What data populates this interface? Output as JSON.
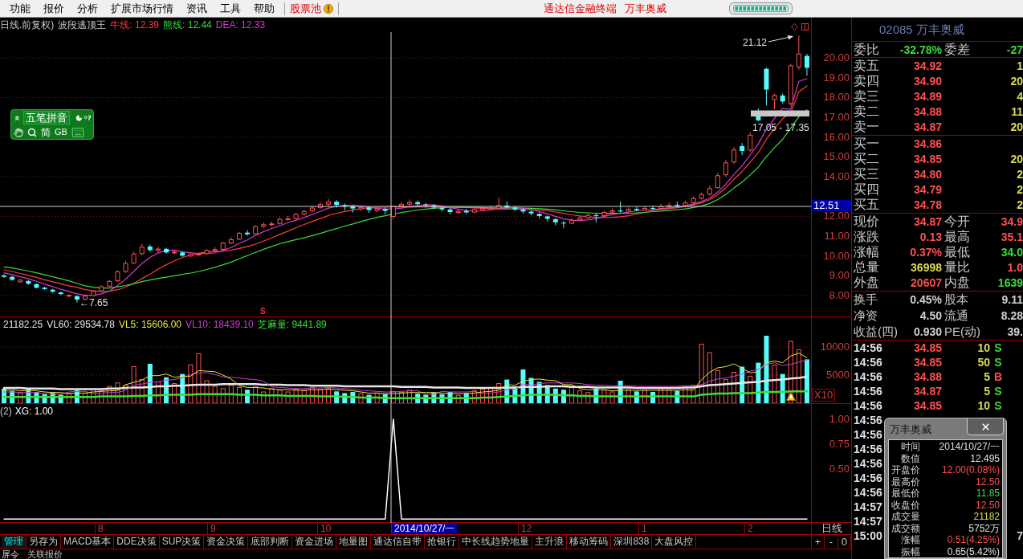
{
  "menu_bar": {
    "items": [
      "功能",
      "报价",
      "分析",
      "扩展市场行情",
      "资讯",
      "工具",
      "帮助"
    ],
    "stock_pool": "股票池",
    "app_title": "通达信金融终端",
    "stock_name": "万丰奥威"
  },
  "main_chart": {
    "title": "日线.前复权)",
    "indicator_name": "波段逃顶王",
    "crosshair_price": "12.51",
    "range_label": "17.05 - 17.35",
    "high_label": "21.12",
    "low_label": "←7.65",
    "signal_mark": "S",
    "chart_data": {
      "type": "candlestick",
      "grid": true,
      "ylim": [
        6.95,
        22.03
      ],
      "yticks": [
        {
          "value": 20,
          "label": "20.00"
        },
        {
          "value": 19,
          "label": "19.00"
        },
        {
          "value": 18,
          "label": "18.00"
        },
        {
          "value": 17,
          "label": "17.00"
        },
        {
          "value": 16,
          "label": "16.00"
        },
        {
          "value": 15,
          "label": "15.00"
        },
        {
          "value": 14,
          "label": "14.00"
        },
        {
          "value": 12,
          "label": "12.00"
        },
        {
          "value": 11,
          "label": "11.00"
        },
        {
          "value": 10,
          "label": "10.00"
        },
        {
          "value": 9,
          "label": "9.00"
        },
        {
          "value": 8,
          "label": "8.00"
        }
      ],
      "ohlc": [
        [
          9.02,
          9.08,
          8.9,
          8.95
        ],
        [
          8.95,
          8.99,
          8.76,
          8.8
        ],
        [
          8.7,
          8.84,
          8.66,
          8.78
        ],
        [
          8.74,
          8.78,
          8.55,
          8.6
        ],
        [
          8.58,
          8.62,
          8.36,
          8.4
        ],
        [
          8.4,
          8.45,
          8.28,
          8.33
        ],
        [
          8.3,
          8.34,
          8.14,
          8.2
        ],
        [
          8.16,
          8.2,
          8.02,
          8.08
        ],
        [
          7.98,
          8.06,
          7.92,
          8.02
        ],
        [
          7.98,
          8.0,
          7.65,
          7.8
        ],
        [
          7.82,
          8.02,
          7.78,
          7.98
        ],
        [
          8.0,
          8.28,
          7.96,
          8.22
        ],
        [
          8.24,
          8.52,
          8.2,
          8.45
        ],
        [
          8.48,
          8.8,
          8.44,
          8.72
        ],
        [
          8.75,
          9.28,
          8.7,
          9.2
        ],
        [
          9.22,
          9.75,
          9.15,
          9.62
        ],
        [
          9.65,
          10.22,
          9.6,
          10.1
        ],
        [
          10.12,
          10.62,
          10.05,
          10.45
        ],
        [
          10.48,
          10.58,
          10.22,
          10.3
        ],
        [
          10.3,
          10.45,
          10.2,
          10.35
        ],
        [
          10.36,
          10.42,
          10.12,
          10.18
        ],
        [
          10.16,
          10.28,
          10.08,
          10.2
        ],
        [
          10.18,
          10.24,
          9.96,
          10.02
        ],
        [
          10.0,
          10.15,
          9.95,
          10.08
        ],
        [
          10.08,
          10.18,
          10.02,
          10.1
        ],
        [
          10.12,
          10.35,
          10.06,
          10.28
        ],
        [
          10.3,
          10.45,
          10.22,
          10.32
        ],
        [
          10.34,
          10.72,
          10.3,
          10.65
        ],
        [
          10.66,
          10.95,
          10.6,
          10.82
        ],
        [
          10.85,
          11.22,
          10.8,
          11.15
        ],
        [
          11.18,
          11.3,
          11.02,
          11.1
        ],
        [
          11.12,
          11.55,
          11.08,
          11.48
        ],
        [
          11.5,
          11.7,
          11.42,
          11.58
        ],
        [
          11.6,
          11.75,
          11.5,
          11.62
        ],
        [
          11.64,
          11.95,
          11.58,
          11.85
        ],
        [
          11.86,
          12.02,
          11.78,
          11.88
        ],
        [
          11.9,
          12.18,
          11.85,
          12.1
        ],
        [
          12.12,
          12.35,
          12.05,
          12.25
        ],
        [
          12.28,
          12.55,
          12.2,
          12.42
        ],
        [
          12.45,
          12.72,
          12.38,
          12.6
        ],
        [
          12.62,
          12.88,
          12.5,
          12.72
        ],
        [
          12.74,
          12.82,
          12.45,
          12.58
        ],
        [
          12.56,
          12.65,
          12.3,
          12.5
        ],
        [
          12.5,
          12.58,
          12.2,
          12.4
        ],
        [
          12.38,
          12.55,
          12.28,
          12.45
        ],
        [
          12.45,
          12.52,
          12.18,
          12.32
        ],
        [
          12.3,
          12.48,
          12.22,
          12.38
        ],
        [
          12.38,
          12.45,
          12.1,
          12.28
        ],
        [
          12.0,
          12.5,
          11.85,
          12.5
        ],
        [
          12.52,
          12.72,
          12.45,
          12.6
        ],
        [
          12.62,
          12.85,
          12.55,
          12.7
        ],
        [
          12.72,
          12.8,
          12.52,
          12.62
        ],
        [
          12.6,
          12.68,
          12.45,
          12.55
        ],
        [
          12.55,
          12.62,
          12.38,
          12.45
        ],
        [
          12.42,
          12.5,
          12.25,
          12.35
        ],
        [
          12.35,
          12.42,
          12.1,
          12.22
        ],
        [
          12.2,
          12.35,
          12.12,
          12.26
        ],
        [
          12.28,
          12.38,
          12.12,
          12.2
        ],
        [
          12.22,
          12.42,
          12.18,
          12.34
        ],
        [
          12.34,
          12.48,
          12.28,
          12.4
        ],
        [
          12.4,
          12.55,
          12.32,
          12.44
        ],
        [
          12.42,
          12.95,
          12.38,
          12.55
        ],
        [
          12.55,
          12.75,
          12.4,
          12.45
        ],
        [
          12.45,
          12.52,
          12.25,
          12.35
        ],
        [
          12.35,
          12.42,
          12.15,
          12.25
        ],
        [
          12.24,
          12.3,
          12.05,
          12.15
        ],
        [
          12.12,
          12.2,
          11.92,
          12.02
        ],
        [
          12.0,
          12.05,
          11.75,
          11.88
        ],
        [
          11.86,
          11.92,
          11.55,
          11.7
        ],
        [
          11.68,
          11.78,
          11.4,
          11.66
        ],
        [
          11.66,
          11.9,
          11.6,
          11.8
        ],
        [
          11.82,
          12.02,
          11.75,
          11.92
        ],
        [
          11.94,
          12.15,
          11.88,
          12.05
        ],
        [
          12.06,
          12.18,
          11.7,
          12.02
        ],
        [
          12.04,
          12.3,
          11.98,
          12.2
        ],
        [
          12.22,
          12.4,
          12.15,
          12.28
        ],
        [
          12.3,
          12.75,
          12.18,
          12.25
        ],
        [
          12.26,
          12.45,
          12.2,
          12.36
        ],
        [
          12.38,
          12.48,
          12.25,
          12.32
        ],
        [
          12.32,
          12.52,
          12.28,
          12.4
        ],
        [
          12.42,
          12.55,
          12.3,
          12.38
        ],
        [
          12.4,
          12.62,
          12.35,
          12.5
        ],
        [
          12.5,
          12.7,
          12.42,
          12.55
        ],
        [
          12.58,
          12.75,
          12.45,
          12.52
        ],
        [
          12.55,
          12.8,
          12.5,
          12.68
        ],
        [
          12.7,
          13.0,
          12.62,
          12.9
        ],
        [
          12.92,
          13.2,
          12.85,
          13.1
        ],
        [
          13.12,
          13.55,
          13.05,
          13.4
        ],
        [
          13.45,
          14.2,
          13.4,
          14.05
        ],
        [
          14.1,
          14.85,
          14.0,
          14.7
        ],
        [
          14.75,
          15.5,
          14.65,
          15.35
        ],
        [
          15.55,
          15.7,
          15.1,
          15.3
        ],
        [
          15.35,
          16.25,
          15.25,
          16.1
        ],
        [
          17.3,
          17.45,
          16.8,
          16.85
        ],
        [
          19.45,
          19.5,
          17.6,
          18.4
        ],
        [
          17.9,
          18.2,
          17.4,
          18.1
        ],
        [
          18.1,
          18.2,
          17.7,
          17.8
        ],
        [
          17.7,
          19.7,
          17.6,
          19.6
        ],
        [
          19.55,
          21.12,
          19.4,
          20.2
        ],
        [
          20.1,
          20.2,
          19.1,
          19.5
        ]
      ],
      "series": [
        {
          "type": "line",
          "name": "牛线: 12.39",
          "color": "#ff3c3c",
          "values": [
            9.3,
            9.22,
            9.12,
            9.02,
            8.92,
            8.8,
            8.7,
            8.6,
            8.5,
            8.42,
            8.3,
            8.24,
            8.21,
            8.22,
            8.3,
            8.43,
            8.62,
            8.86,
            9.08,
            9.34,
            9.56,
            9.76,
            9.92,
            10.05,
            10.14,
            10.21,
            10.23,
            10.25,
            10.3,
            10.38,
            10.48,
            10.6,
            10.76,
            10.91,
            11.09,
            11.25,
            11.43,
            11.59,
            11.75,
            11.89,
            12.05,
            12.16,
            12.25,
            12.33,
            12.39,
            12.44,
            12.46,
            12.47,
            12.48,
            12.48,
            12.47,
            12.48,
            12.48,
            12.49,
            12.48,
            12.47,
            12.46,
            12.45,
            12.43,
            12.41,
            12.39,
            12.38,
            12.37,
            12.36,
            12.35,
            12.34,
            12.32,
            12.29,
            12.22,
            12.15,
            12.08,
            12.02,
            11.98,
            11.95,
            11.94,
            11.95,
            11.98,
            12.03,
            12.12,
            12.2,
            12.3,
            12.35,
            12.4,
            12.44,
            12.5,
            12.58,
            12.69,
            12.84,
            13.1,
            13.45,
            13.87,
            14.26,
            14.74,
            15.21,
            15.9,
            16.44,
            16.93,
            17.2,
            18.29,
            18.59
          ]
        },
        {
          "type": "line",
          "name": "熊线: 12.44",
          "color": "#3cdc3c",
          "values": [
            9.45,
            9.4,
            9.32,
            9.24,
            9.15,
            9.05,
            8.95,
            8.85,
            8.75,
            8.62,
            8.5,
            8.42,
            8.38,
            8.38,
            8.44,
            8.51,
            8.6,
            8.71,
            8.79,
            8.87,
            8.93,
            9.0,
            9.07,
            9.14,
            9.22,
            9.32,
            9.43,
            9.56,
            9.69,
            9.86,
            10.02,
            10.18,
            10.34,
            10.48,
            10.62,
            10.73,
            10.83,
            10.92,
            11.03,
            11.14,
            11.27,
            11.38,
            11.51,
            11.62,
            11.74,
            11.85,
            11.95,
            12.03,
            12.12,
            12.19,
            12.26,
            12.32,
            12.37,
            12.41,
            12.44,
            12.46,
            12.46,
            12.46,
            12.46,
            12.45,
            12.43,
            12.43,
            12.43,
            12.43,
            12.42,
            12.41,
            12.39,
            12.37,
            12.33,
            12.28,
            12.24,
            12.2,
            12.18,
            12.16,
            12.15,
            12.15,
            12.15,
            12.16,
            12.17,
            12.2,
            12.24,
            12.27,
            12.31,
            12.34,
            12.38,
            12.45,
            12.53,
            12.65,
            12.85,
            13.11,
            13.43,
            13.73,
            14.09,
            14.48,
            15.02,
            15.47,
            15.89,
            16.45,
            17.03,
            17.38
          ]
        },
        {
          "type": "line",
          "name": "DEA: 12.33",
          "color": "#d23cd2",
          "values": [
            9.15,
            9.05,
            8.95,
            8.85,
            8.72,
            8.58,
            8.46,
            8.32,
            8.21,
            8.09,
            8.02,
            8.02,
            8.09,
            8.23,
            8.51,
            8.84,
            9.22,
            9.62,
            9.93,
            10.16,
            10.28,
            10.3,
            10.21,
            10.17,
            10.12,
            10.14,
            10.16,
            10.29,
            10.43,
            10.64,
            10.81,
            11.04,
            11.23,
            11.39,
            11.53,
            11.68,
            11.81,
            11.94,
            12.1,
            12.25,
            12.42,
            12.51,
            12.56,
            12.56,
            12.53,
            12.45,
            12.41,
            12.37,
            12.39,
            12.42,
            12.49,
            12.54,
            12.59,
            12.58,
            12.53,
            12.44,
            12.37,
            12.3,
            12.27,
            12.28,
            12.33,
            12.39,
            12.44,
            12.44,
            12.41,
            12.35,
            12.24,
            12.13,
            12.0,
            11.88,
            11.81,
            11.79,
            11.83,
            11.89,
            12.0,
            12.09,
            12.16,
            12.22,
            12.28,
            12.32,
            12.34,
            12.39,
            12.43,
            12.47,
            12.53,
            12.63,
            12.75,
            12.92,
            13.23,
            13.63,
            14.12,
            14.56,
            15.1,
            15.66,
            16.4,
            16.95,
            17.45,
            17.4,
            18.82,
            18.95
          ]
        }
      ]
    }
  },
  "input_method": {
    "mode": "五笔拼音",
    "script": "简",
    "charset": "GB"
  },
  "volume_chart": {
    "reading": "21182.25",
    "scale": "X10",
    "chart_data": {
      "type": "bar",
      "stacked": true,
      "grid": true,
      "ylim": [
        0,
        15285
      ],
      "yticks": [
        {
          "value": 10000,
          "label": "10000"
        },
        {
          "value": 5000,
          "label": "5000"
        }
      ],
      "series": [
        {
          "type": "bar",
          "color": "#ff5050",
          "values": [
            null,
            null,
            1800,
            null,
            null,
            null,
            null,
            null,
            1700,
            null,
            1800,
            2500,
            2200,
            3000,
            3600,
            3200,
            6500,
            4200,
            null,
            3800,
            null,
            3500,
            null,
            6800,
            8800,
            4000,
            3000,
            2600,
            3200,
            2800,
            null,
            2900,
            2000,
            2600,
            2300,
            2000,
            2500,
            2200,
            2800,
            2400,
            2600,
            null,
            null,
            null,
            1700,
            null,
            1800,
            null,
            2100,
            1900,
            2300,
            null,
            null,
            null,
            null,
            null,
            1400,
            null,
            2200,
            2500,
            2800,
            3500,
            null,
            null,
            null,
            null,
            null,
            null,
            null,
            null,
            2800,
            2200,
            1900,
            null,
            2300,
            2000,
            null,
            2400,
            null,
            2300,
            null,
            2600,
            2400,
            null,
            2800,
            3200,
            10500,
            9000,
            5800,
            4200,
            5500,
            null,
            4800,
            null,
            null,
            6800,
            null,
            11000,
            9500,
            null
          ]
        },
        {
          "type": "bar",
          "color": "#54fcfc",
          "values": [
            2600,
            2200,
            null,
            2400,
            2000,
            1600,
            1900,
            1500,
            null,
            2300,
            null,
            null,
            null,
            null,
            null,
            null,
            null,
            null,
            7000,
            null,
            4600,
            null,
            5200,
            null,
            null,
            null,
            null,
            null,
            null,
            null,
            2400,
            null,
            null,
            null,
            null,
            null,
            null,
            null,
            null,
            null,
            null,
            2100,
            1800,
            2000,
            null,
            1500,
            null,
            1600,
            null,
            null,
            null,
            1700,
            1500,
            1900,
            1600,
            2000,
            null,
            1800,
            null,
            null,
            null,
            null,
            4200,
            3000,
            6000,
            4500,
            3800,
            3200,
            2600,
            2400,
            null,
            null,
            null,
            2600,
            null,
            null,
            4000,
            null,
            2100,
            null,
            2000,
            null,
            null,
            2200,
            null,
            null,
            null,
            null,
            null,
            null,
            null,
            6500,
            null,
            7200,
            12000,
            null,
            5200,
            null,
            null,
            7800
          ]
        },
        {
          "type": "line",
          "name": "VL60: 29534.78",
          "color": "#e6e6e6",
          "values": [
            2700,
            2700,
            2700,
            2600,
            2600,
            2600,
            2600,
            2500,
            2500,
            2500,
            2500,
            2500,
            2500,
            2600,
            2600,
            2700,
            2800,
            2800,
            2900,
            3000,
            3000,
            3100,
            3100,
            3200,
            3300,
            3300,
            3300,
            3400,
            3400,
            3400,
            3400,
            3400,
            3300,
            3300,
            3300,
            3200,
            3200,
            3200,
            3100,
            3100,
            3100,
            3100,
            3000,
            3000,
            3000,
            3000,
            3000,
            3000,
            3000,
            2900,
            2900,
            2900,
            2900,
            2800,
            2800,
            2800,
            2800,
            2700,
            2700,
            2700,
            2700,
            2700,
            2800,
            2800,
            2900,
            2900,
            2900,
            3000,
            3000,
            3000,
            2900,
            2900,
            2900,
            2800,
            2800,
            2800,
            2800,
            2800,
            2700,
            2700,
            2700,
            2700,
            2700,
            2700,
            2800,
            2800,
            3000,
            3200,
            3300,
            3400,
            3500,
            3600,
            3700,
            3800,
            4000,
            4100,
            4200,
            4400,
            4500,
            4700
          ]
        },
        {
          "type": "line",
          "name": "VL5: 15606.00",
          "color": "#e6e63c",
          "values": [
            2300,
            2400,
            2200,
            2300,
            2200,
            2000,
            1900,
            1900,
            1700,
            1800,
            1800,
            2000,
            2100,
            2200,
            2200,
            3300,
            3700,
            4100,
            4900,
            4900,
            5200,
            4600,
            4800,
            4800,
            5800,
            5700,
            5600,
            5000,
            4300,
            3100,
            2800,
            2800,
            2700,
            2500,
            2400,
            2400,
            2300,
            2300,
            2400,
            2400,
            2500,
            2400,
            2300,
            2200,
            2000,
            1800,
            1800,
            1700,
            1700,
            1800,
            1900,
            1900,
            1900,
            1900,
            1800,
            1700,
            1700,
            1700,
            1800,
            2000,
            2100,
            2300,
            3300,
            3200,
            3900,
            4200,
            4300,
            4100,
            4000,
            3300,
            3300,
            2600,
            2400,
            2400,
            2400,
            2200,
            2300,
            2300,
            2300,
            2300,
            2300,
            2300,
            2300,
            2300,
            2400,
            2300,
            4200,
            5500,
            6300,
            6500,
            7000,
            6200,
            5400,
            5600,
            7200,
            7500,
            7200,
            8400,
            8900,
            8100
          ]
        },
        {
          "type": "line",
          "name": "VL10: 18439.10",
          "color": "#d23cd2",
          "values": [
            2000,
            2000,
            1900,
            1900,
            1900,
            1700,
            1600,
            1600,
            2000,
            2100,
            2100,
            1700,
            1800,
            1900,
            1900,
            2300,
            3200,
            3400,
            3700,
            3800,
            4100,
            4200,
            4500,
            5100,
            5400,
            5400,
            5100,
            4700,
            4600,
            4500,
            4300,
            4200,
            3900,
            2900,
            2800,
            2700,
            2600,
            2600,
            2700,
            2700,
            2800,
            2700,
            2600,
            2500,
            2300,
            2200,
            2100,
            2000,
            2000,
            2100,
            2200,
            2200,
            1600,
            1600,
            2100,
            2000,
            2000,
            2000,
            2100,
            1700,
            1800,
            2000,
            2400,
            2500,
            3400,
            3200,
            3500,
            3600,
            3600,
            3600,
            3600,
            3500,
            3300,
            3200,
            3200,
            3100,
            3100,
            3100,
            3000,
            3000,
            3000,
            3000,
            3000,
            3000,
            3100,
            3100,
            3300,
            3900,
            4300,
            4500,
            4800,
            5200,
            5700,
            6000,
            6900,
            7200,
            6700,
            6900,
            7300,
            7700
          ]
        },
        {
          "type": "line",
          "name": "芝麻量: 9441.89",
          "color": "#3cdc3c",
          "values": [
            1100,
            1100,
            1100,
            1100,
            1100,
            1100,
            1100,
            1100,
            1100,
            1100,
            1100,
            1100,
            1200,
            1200,
            1200,
            1200,
            1300,
            1300,
            1400,
            1400,
            1500,
            1500,
            1500,
            1500,
            1600,
            1600,
            1600,
            1600,
            1600,
            1500,
            1500,
            1500,
            1400,
            1400,
            1400,
            1300,
            1300,
            1300,
            1300,
            1200,
            1200,
            1200,
            1100,
            1100,
            1000,
            1000,
            1000,
            900,
            900,
            900,
            900,
            900,
            900,
            900,
            900,
            900,
            900,
            900,
            900,
            1000,
            1000,
            1100,
            1200,
            1300,
            1400,
            1500,
            1500,
            1500,
            1500,
            1400,
            1400,
            1300,
            1300,
            1200,
            1200,
            1200,
            1200,
            1200,
            1200,
            1200,
            1200,
            1200,
            1200,
            1200,
            1200,
            1200,
            1500,
            1600,
            1700,
            1700,
            1800,
            1800,
            1800,
            1900,
            2000,
            2000,
            2000,
            2100,
            2100,
            2100
          ]
        }
      ]
    }
  },
  "indicator_chart": {
    "prefix": "(2)",
    "chart_data": {
      "type": "line",
      "ylim": [
        -0.03,
        1.15
      ],
      "yticks": [
        {
          "value": 1,
          "label": "1.00"
        },
        {
          "value": 0.75,
          "label": "0.75"
        },
        {
          "value": 0.5,
          "label": "0.50"
        }
      ],
      "series": [
        {
          "name": "XG: 1.00",
          "color": "#ffffff",
          "values": [
            0,
            0,
            0,
            0,
            0,
            0,
            0,
            0,
            0,
            0,
            0,
            0,
            0,
            0,
            0,
            0,
            0,
            0,
            0,
            0,
            0,
            0,
            0,
            0,
            0,
            0,
            0,
            0,
            0,
            0,
            0,
            0,
            0,
            0,
            0,
            0,
            0,
            0,
            0,
            0,
            0,
            0,
            0,
            0,
            0,
            0,
            0,
            0,
            1,
            0,
            0,
            0,
            0,
            0,
            0,
            0,
            0,
            0,
            0,
            0,
            0,
            0,
            0,
            0,
            0,
            0,
            0,
            0,
            0,
            0,
            0,
            0,
            0,
            0,
            0,
            0,
            0,
            0,
            0,
            0,
            0,
            0,
            0,
            0,
            0,
            0,
            0,
            0,
            0,
            0,
            0,
            0,
            0,
            0,
            0,
            0,
            0,
            0,
            0,
            0
          ]
        }
      ]
    }
  },
  "date_axis": [
    {
      "label": "8",
      "selected": false
    },
    {
      "label": "9",
      "selected": false
    },
    {
      "label": "10",
      "selected": false
    },
    {
      "label": "2014/10/27/一",
      "selected": true
    },
    {
      "label": "12",
      "selected": false
    },
    {
      "label": "1",
      "selected": false
    },
    {
      "label": "2",
      "selected": false
    }
  ],
  "period": "日线",
  "zoom_buttons": [
    "+",
    "-",
    "0"
  ],
  "tabs": [
    {
      "label": "管理",
      "selected": true
    },
    {
      "label": "另存为",
      "selected": false
    },
    {
      "label": "MACD基本",
      "selected": false
    },
    {
      "label": "DDE决策",
      "selected": false
    },
    {
      "label": "SUP决策",
      "selected": false
    },
    {
      "label": "资金决策",
      "selected": false
    },
    {
      "label": "底部判断",
      "selected": false
    },
    {
      "label": "资金进场",
      "selected": false
    },
    {
      "label": "地量图",
      "selected": false
    },
    {
      "label": "通达信自带",
      "selected": false
    },
    {
      "label": "抢银行",
      "selected": false
    },
    {
      "label": "中长线趋势地量",
      "selected": false
    },
    {
      "label": "主升浪",
      "selected": false
    },
    {
      "label": "移动筹码",
      "selected": false
    },
    {
      "label": "深圳838",
      "selected": false
    },
    {
      "label": "大盘风控",
      "selected": false
    }
  ],
  "bottom_bar": [
    "屏令",
    "关联报价"
  ],
  "quote_panel": {
    "header": "02085 万丰奥威",
    "ratio": [
      {
        "label": "委比",
        "value": "-32.78%",
        "color": "#3cdc3c"
      },
      {
        "label": "委差",
        "value": "-27",
        "color": "#3cdc3c"
      }
    ],
    "asks": [
      {
        "label": "卖五",
        "price": "34.92",
        "volume": "1"
      },
      {
        "label": "卖四",
        "price": "34.90",
        "volume": "20"
      },
      {
        "label": "卖三",
        "price": "34.89",
        "volume": "4"
      },
      {
        "label": "卖二",
        "price": "34.88",
        "volume": "11"
      },
      {
        "label": "卖一",
        "price": "34.87",
        "volume": "20"
      }
    ],
    "bids": [
      {
        "label": "买一",
        "price": "34.86"
      },
      {
        "label": "买二",
        "price": "34.85",
        "volume": "20"
      },
      {
        "label": "买三",
        "price": "34.80",
        "volume": "2"
      },
      {
        "label": "买四",
        "price": "34.79",
        "volume": "2"
      },
      {
        "label": "买五",
        "price": "34.78",
        "volume": "2"
      }
    ],
    "stats": [
      {
        "label": "现价",
        "value": "34.87",
        "color": "#ff5050"
      },
      {
        "label": "今开",
        "value": "34.9",
        "color": "#ff5050"
      },
      {
        "label": "涨跌",
        "value": "0.13",
        "color": "#ff5050"
      },
      {
        "label": "最高",
        "value": "35.1",
        "color": "#ff5050"
      },
      {
        "label": "涨幅",
        "value": "0.37%",
        "color": "#ff5050"
      },
      {
        "label": "最低",
        "value": "34.0",
        "color": "#3cdc3c"
      },
      {
        "label": "总量",
        "value": "36998",
        "color": "#dcdc50"
      },
      {
        "label": "量比",
        "value": "1.0",
        "color": "#ff5050"
      },
      {
        "label": "外盘",
        "value": "20607",
        "color": "#ff5050"
      },
      {
        "label": "内盘",
        "value": "1639",
        "color": "#3cdc3c"
      }
    ],
    "fundamentals": [
      {
        "label": "换手",
        "value": "0.45%"
      },
      {
        "label": "股本",
        "value": "9.11"
      },
      {
        "label": "净资",
        "value": "4.50"
      },
      {
        "label": "流通",
        "value": "8.28"
      },
      {
        "label": "收益(四)",
        "value": "0.930"
      },
      {
        "label": "PE(动)",
        "value": "39."
      }
    ],
    "ticks": [
      {
        "time": "14:56",
        "price": "34.85",
        "volume": "10",
        "side": "S",
        "color": "#3cdc3c"
      },
      {
        "time": "14:56",
        "price": "34.85",
        "volume": "50",
        "side": "S",
        "color": "#3cdc3c"
      },
      {
        "time": "14:56",
        "price": "34.88",
        "volume": "5",
        "side": "B",
        "color": "#ff5050"
      },
      {
        "time": "14:56",
        "price": "34.87",
        "volume": "5",
        "side": "S",
        "color": "#3cdc3c"
      },
      {
        "time": "14:56",
        "price": "34.85",
        "volume": "10",
        "side": "S",
        "color": "#3cdc3c"
      },
      {
        "time": "14:56"
      },
      {
        "time": "14:56"
      },
      {
        "time": "14:56"
      },
      {
        "time": "14:56"
      },
      {
        "time": "14:56"
      },
      {
        "time": "14:56"
      },
      {
        "time": "14:57"
      },
      {
        "time": "14:57"
      },
      {
        "time": "15:00",
        "column_5": "7"
      }
    ]
  },
  "popup": {
    "title": "万丰奥威",
    "rows": [
      {
        "label": "时间",
        "value": "2014/10/27/一",
        "color": "#e0e0e0"
      },
      {
        "label": "数值",
        "value": "12.495",
        "color": "#e0e0e0"
      },
      {
        "label": "开盘价",
        "value": "12.00(0.08%)",
        "color": "#ff5050"
      },
      {
        "label": "最高价",
        "value": "12.50",
        "color": "#ff5050"
      },
      {
        "label": "最低价",
        "value": "11.85",
        "color": "#3cdc3c"
      },
      {
        "label": "收盘价",
        "value": "12.50",
        "color": "#ff5050"
      },
      {
        "label": "成交量",
        "value": "21182",
        "color": "#dcdc50"
      },
      {
        "label": "成交额",
        "value": "5752万",
        "color": "#e0e0e0"
      },
      {
        "label": "涨幅",
        "value": "0.51(4.25%)",
        "color": "#ff5050"
      },
      {
        "label": "振幅",
        "value": "0.65(5.42%)",
        "color": "#e0e0e0"
      }
    ]
  }
}
